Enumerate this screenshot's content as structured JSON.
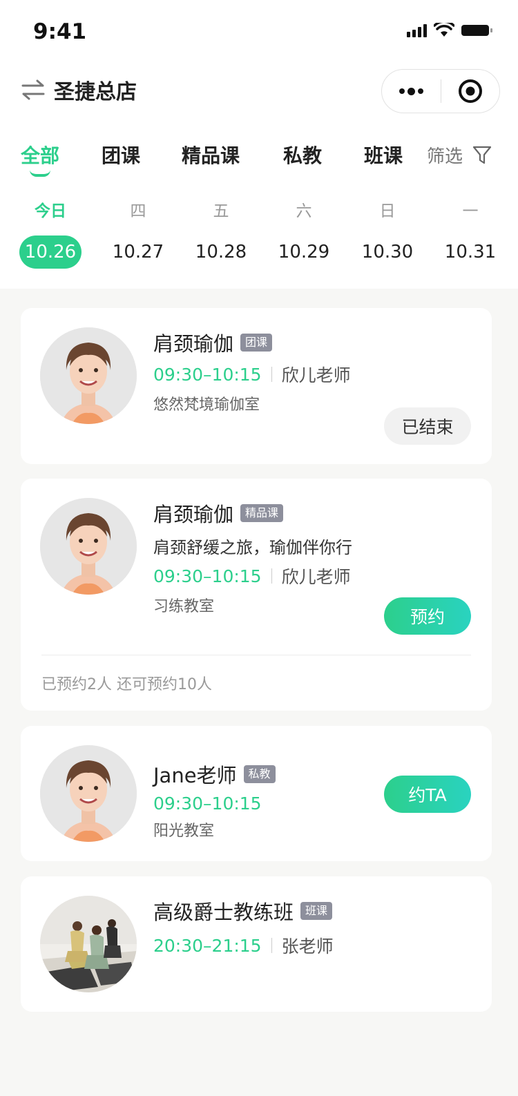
{
  "status_bar": {
    "time": "9:41"
  },
  "nav": {
    "store_name": "圣捷总店"
  },
  "tabs": [
    {
      "label": "全部",
      "active": true
    },
    {
      "label": "团课"
    },
    {
      "label": "精品课"
    },
    {
      "label": "私教"
    },
    {
      "label": "班课"
    }
  ],
  "filter": {
    "label": "筛选"
  },
  "dates": [
    {
      "weekday": "今日",
      "date": "10.26",
      "active": true
    },
    {
      "weekday": "四",
      "date": "10.27"
    },
    {
      "weekday": "五",
      "date": "10.28"
    },
    {
      "weekday": "六",
      "date": "10.29"
    },
    {
      "weekday": "日",
      "date": "10.30"
    },
    {
      "weekday": "一",
      "date": "10.31"
    }
  ],
  "courses": [
    {
      "title": "肩颈瑜伽",
      "badge": "团课",
      "time": "09:30–10:15",
      "teacher": "欣儿老师",
      "room": "悠然梵境瑜伽室",
      "button": "已结束"
    },
    {
      "title": "肩颈瑜伽",
      "badge": "精品课",
      "description": "肩颈舒缓之旅，瑜伽伴你行",
      "time": "09:30–10:15",
      "teacher": "欣儿老师",
      "room": "习练教室",
      "button": "预约",
      "booking_note": "已预约2人 还可预约10人"
    },
    {
      "title": "Jane老师",
      "badge": "私教",
      "time": "09:30–10:15",
      "room": "阳光教室",
      "button": "约TA"
    },
    {
      "title": "高级爵士教练班",
      "badge": "班课",
      "time": "20:30–21:15",
      "teacher": "张老师"
    }
  ],
  "colors": {
    "accent": "#2ccf8c",
    "badge": "#8d8f9c"
  },
  "icons": [
    "switch-store-icon",
    "more-dots-icon",
    "target-close-icon",
    "filter-funnel-icon",
    "signal-icon",
    "wifi-icon",
    "battery-icon"
  ]
}
